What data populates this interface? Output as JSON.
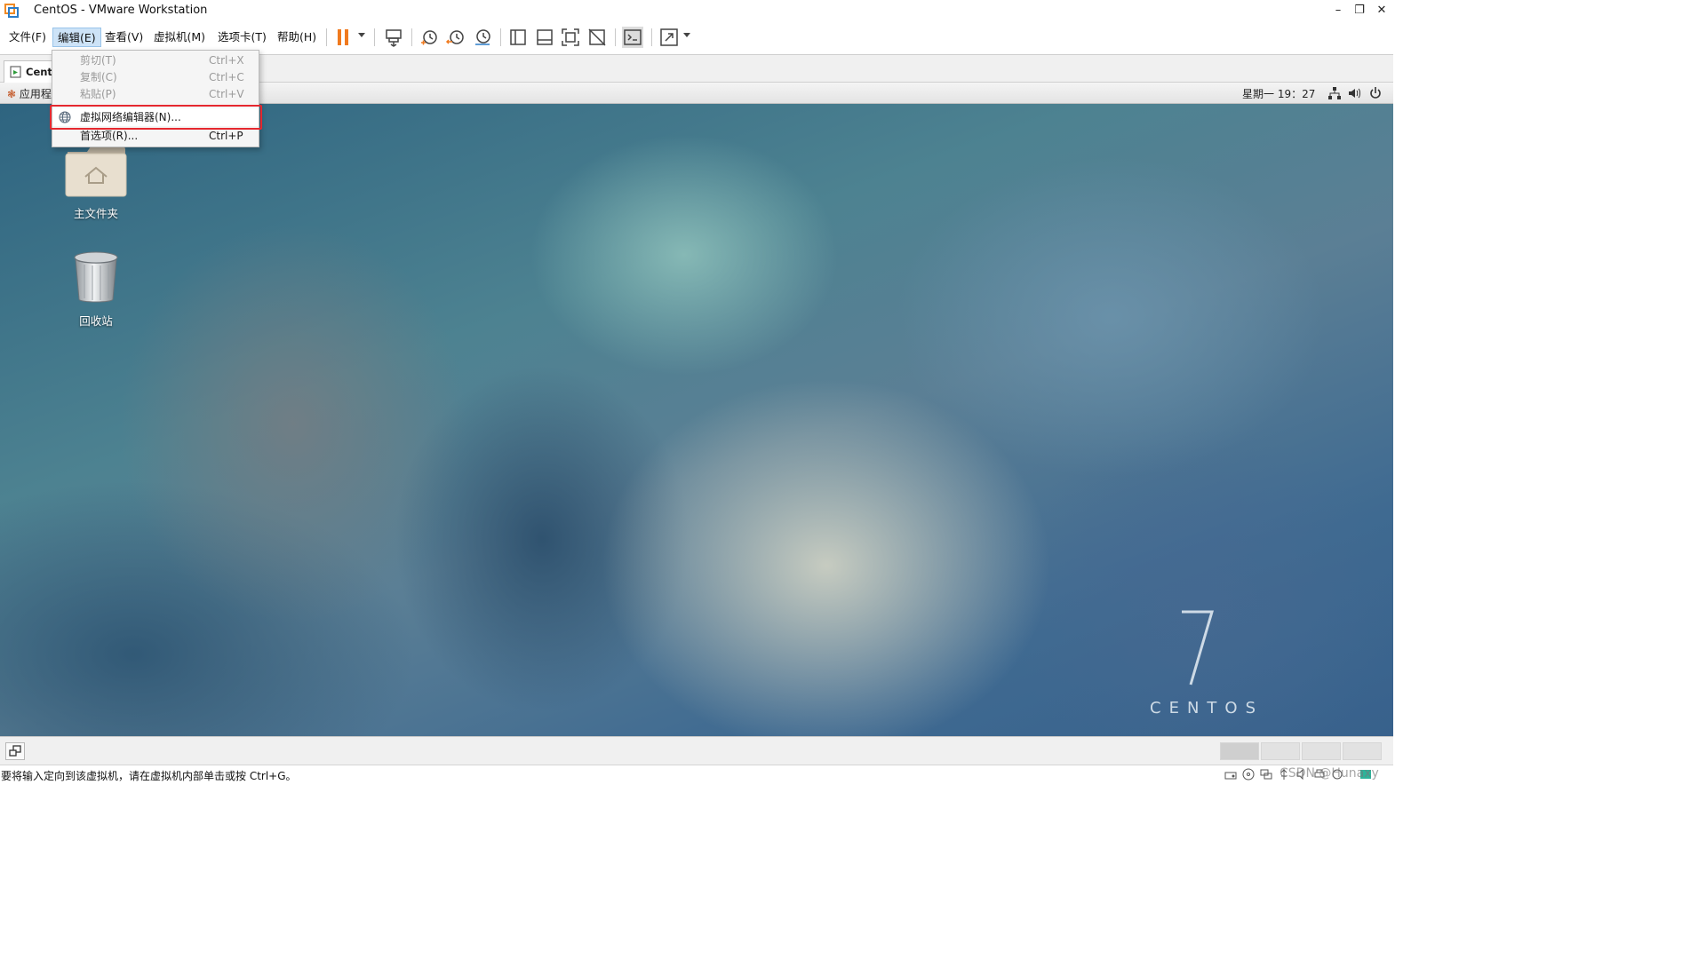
{
  "window": {
    "title": "CentOS - VMware Workstation"
  },
  "menubar": {
    "items": [
      "文件(F)",
      "编辑(E)",
      "查看(V)",
      "虚拟机(M)",
      "选项卡(T)",
      "帮助(H)"
    ]
  },
  "toolbar": {
    "icons": [
      "pause-icon",
      "send-ctrl-alt-del-icon",
      "snapshot-icon",
      "revert-snapshot-icon",
      "snapshot-manager-icon",
      "library-view-icon",
      "thumbnail-view-icon",
      "fullscreen-icon",
      "unity-icon",
      "console-icon",
      "stretch-icon"
    ]
  },
  "edit_menu": {
    "items": [
      {
        "label": "剪切(T)",
        "shortcut": "Ctrl+X",
        "enabled": false
      },
      {
        "label": "复制(C)",
        "shortcut": "Ctrl+C",
        "enabled": false
      },
      {
        "label": "粘贴(P)",
        "shortcut": "Ctrl+V",
        "enabled": false
      },
      {
        "label": "虚拟网络编辑器(N)...",
        "shortcut": "",
        "enabled": true,
        "highlighted": true
      },
      {
        "label": "首选项(R)...",
        "shortcut": "Ctrl+P",
        "enabled": true
      }
    ]
  },
  "vm_tab": {
    "label": "CentOS"
  },
  "guest": {
    "apps_menu": "应用程序",
    "clock": "星期一 19：27",
    "desktop_icons": [
      {
        "label": "主文件夹",
        "icon": "home-folder-icon"
      },
      {
        "label": "回收站",
        "icon": "trash-icon"
      }
    ],
    "branding": {
      "number": "7",
      "word": "CENTOS"
    }
  },
  "statusbar": {
    "message": "要将输入定向到该虚拟机，请在虚拟机内部单击或按 Ctrl+G。",
    "watermark": "CSDN @Hunaxy"
  },
  "colors": {
    "accent_orange": "#f07a1e",
    "highlight_red": "#e5282f",
    "menu_active": "#cde3f7"
  }
}
